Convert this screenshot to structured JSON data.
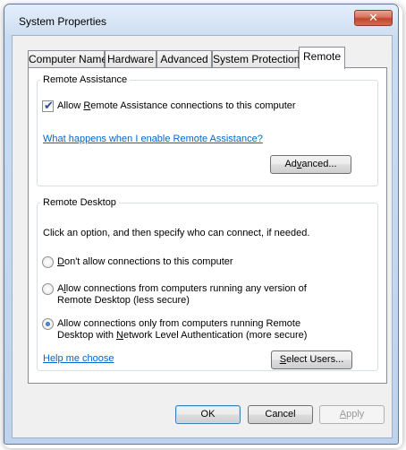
{
  "window": {
    "title": "System Properties",
    "close_glyph": "✕"
  },
  "tabs": [
    {
      "label": "Computer Name"
    },
    {
      "label": "Hardware"
    },
    {
      "label": "Advanced"
    },
    {
      "label": "System Protection"
    },
    {
      "label": "Remote",
      "selected": true
    }
  ],
  "remote_assistance": {
    "group_label": "Remote Assistance",
    "allow_checkbox": {
      "label_pre": "Allow ",
      "label_accel": "R",
      "label_post": "emote Assistance connections to this computer",
      "checked": true
    },
    "help_link": "What happens when I enable Remote Assistance?",
    "advanced_button": {
      "accel": "v",
      "pre": "Ad",
      "post": "anced..."
    }
  },
  "remote_desktop": {
    "group_label": "Remote Desktop",
    "instruction": "Click an option, and then specify who can connect, if needed.",
    "options": [
      {
        "pre": "",
        "accel": "D",
        "post": "on't allow connections to this computer",
        "selected": false
      },
      {
        "line1_pre": "A",
        "line1_accel": "l",
        "line1_post": "low connections from computers running any version of",
        "line2": "Remote Desktop (less secure)",
        "selected": false
      },
      {
        "line1": "Allow connections only from computers running Remote",
        "line2_pre": "Desktop with ",
        "line2_accel": "N",
        "line2_post": "etwork Level Authentication (more secure)",
        "selected": true
      }
    ],
    "help_link": "Help me choose",
    "select_users_button": {
      "pre": "",
      "accel": "S",
      "post": "elect Users..."
    }
  },
  "footer": {
    "ok_label": "OK",
    "cancel_label": "Cancel",
    "apply_pre": "",
    "apply_accel": "A",
    "apply_post": "pply"
  },
  "colors": {
    "link": "#0066cc",
    "close_button": "#c0462c",
    "accent": "#3c7fb1"
  }
}
